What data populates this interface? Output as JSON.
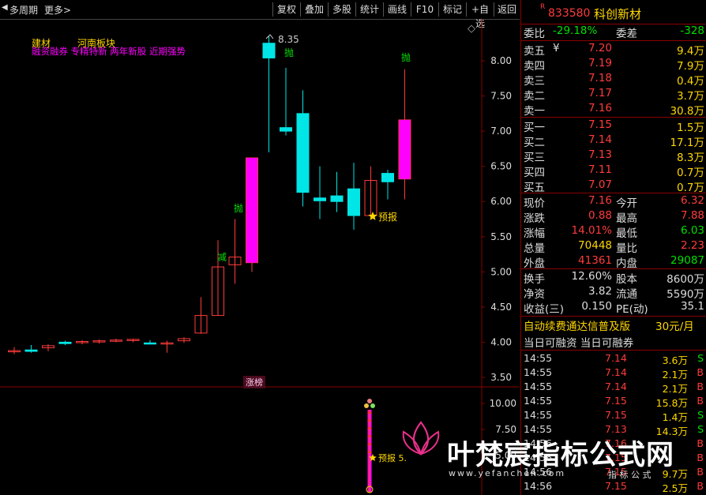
{
  "topbar": {
    "period_label": "多周期",
    "more_label": "更多>",
    "buttons": [
      "复权",
      "叠加",
      "多股",
      "统计",
      "画线",
      "F10",
      "标记",
      "+自选",
      "返回"
    ]
  },
  "chart_data": {
    "type": "candlestick",
    "price_ticks": [
      "8.00",
      "7.50",
      "7.00",
      "6.50",
      "6.00",
      "5.50",
      "5.00",
      "4.50",
      "4.00",
      "3.50"
    ],
    "ylim": [
      3.35,
      8.55
    ],
    "sub_ticks": [
      "10.00",
      "7.50",
      "5.00"
    ],
    "candles": [
      {
        "o": 3.88,
        "h": 3.93,
        "l": 3.83,
        "c": 3.88
      },
      {
        "o": 3.89,
        "h": 3.96,
        "l": 3.85,
        "c": 3.87
      },
      {
        "o": 3.92,
        "h": 3.97,
        "l": 3.87,
        "c": 3.95
      },
      {
        "o": 4.0,
        "h": 4.02,
        "l": 3.96,
        "c": 3.98
      },
      {
        "o": 4.0,
        "h": 4.03,
        "l": 3.97,
        "c": 4.01
      },
      {
        "o": 4.01,
        "h": 4.04,
        "l": 3.98,
        "c": 4.02
      },
      {
        "o": 4.03,
        "h": 4.05,
        "l": 4.0,
        "c": 4.03
      },
      {
        "o": 4.03,
        "h": 4.05,
        "l": 4.0,
        "c": 4.04
      },
      {
        "o": 3.99,
        "h": 4.03,
        "l": 3.97,
        "c": 3.98
      },
      {
        "o": 3.98,
        "h": 4.02,
        "l": 3.85,
        "c": 3.99
      },
      {
        "o": 4.02,
        "h": 4.07,
        "l": 3.99,
        "c": 4.05
      },
      {
        "o": 4.13,
        "h": 4.64,
        "l": 4.12,
        "c": 4.38
      },
      {
        "o": 4.38,
        "h": 5.45,
        "l": 4.38,
        "c": 5.07
      },
      {
        "o": 5.1,
        "h": 5.75,
        "l": 4.83,
        "c": 5.21
      },
      {
        "o": 5.13,
        "h": 6.62,
        "l": 5.0,
        "c": 6.62
      },
      {
        "o": 8.25,
        "h": 8.35,
        "l": 6.7,
        "c": 8.04
      },
      {
        "o": 7.05,
        "h": 7.9,
        "l": 6.94,
        "c": 7.0
      },
      {
        "o": 7.25,
        "h": 7.58,
        "l": 5.93,
        "c": 6.13
      },
      {
        "o": 6.05,
        "h": 6.5,
        "l": 5.75,
        "c": 6.01
      },
      {
        "o": 6.08,
        "h": 6.42,
        "l": 5.85,
        "c": 6.0
      },
      {
        "o": 6.18,
        "h": 6.55,
        "l": 5.6,
        "c": 5.8
      },
      {
        "o": 5.8,
        "h": 6.5,
        "l": 5.77,
        "c": 6.3
      },
      {
        "o": 6.4,
        "h": 6.45,
        "l": 6.03,
        "c": 6.28
      },
      {
        "o": 6.32,
        "h": 7.88,
        "l": 6.03,
        "c": 7.16
      }
    ]
  },
  "chart_labels": {
    "sector1": "建材",
    "sector2": "河南板块",
    "tags": "融资融券 专精特新 两年新股 近期强势",
    "max_price": "8.35",
    "sell_mark": "抛",
    "reduce_mark": "减",
    "forecast_mark": "预报",
    "limit_label": "涨榜",
    "diamond_icon": "◇",
    "sub_forecast": "预报 5.",
    "sub_num": "5"
  },
  "panel": {
    "badge": "R",
    "code": "833580",
    "name": "科创新材",
    "commit_ratio_label": "委比",
    "commit_ratio": "-29.18%",
    "commit_diff_label": "委差",
    "commit_diff": "-328",
    "asks": [
      {
        "label": "卖五",
        "price": "7.20",
        "vol": "9.4万",
        "mark": "¥"
      },
      {
        "label": "卖四",
        "price": "7.19",
        "vol": "7.9万",
        "mark": ""
      },
      {
        "label": "卖三",
        "price": "7.18",
        "vol": "0.4万",
        "mark": ""
      },
      {
        "label": "卖二",
        "price": "7.17",
        "vol": "3.7万",
        "mark": ""
      },
      {
        "label": "卖一",
        "price": "7.16",
        "vol": "30.8万",
        "mark": ""
      }
    ],
    "bids": [
      {
        "label": "买一",
        "price": "7.15",
        "vol": "1.5万"
      },
      {
        "label": "买二",
        "price": "7.14",
        "vol": "17.1万"
      },
      {
        "label": "买三",
        "price": "7.13",
        "vol": "8.3万"
      },
      {
        "label": "买四",
        "price": "7.11",
        "vol": "0.7万"
      },
      {
        "label": "买五",
        "price": "7.07",
        "vol": "0.7万"
      }
    ],
    "stats": [
      {
        "l1": "现价",
        "v1": "7.16",
        "c1": "#ff3b3b",
        "l2": "今开",
        "v2": "6.32",
        "c2": "#ff3b3b"
      },
      {
        "l1": "涨跌",
        "v1": "0.88",
        "c1": "#ff3b3b",
        "l2": "最高",
        "v2": "7.88",
        "c2": "#ff3b3b"
      },
      {
        "l1": "涨幅",
        "v1": "14.01%",
        "c1": "#ff3b3b",
        "l2": "最低",
        "v2": "6.03",
        "c2": "#00e000"
      },
      {
        "l1": "总量",
        "v1": "70448",
        "c1": "#ffd700",
        "l2": "量比",
        "v2": "2.23",
        "c2": "#ff3b3b"
      },
      {
        "l1": "外盘",
        "v1": "41361",
        "c1": "#ff3b3b",
        "l2": "内盘",
        "v2": "29087",
        "c2": "#00e000"
      }
    ],
    "fund": [
      {
        "l1": "换手",
        "v1": "12.60%",
        "l2": "股本",
        "v2": "8600万"
      },
      {
        "l1": "净资",
        "v1": "3.82",
        "l2": "流通",
        "v2": "5590万"
      },
      {
        "l1": "收益(三)",
        "v1": "0.150",
        "l2": "PE(动)",
        "v2": "35.1"
      }
    ],
    "ad_text": "自动续费通达信普及版",
    "ad_price": "30元/月",
    "margin_text": "当日可融资 当日可融券",
    "ticks": [
      {
        "time": "14:55",
        "price": "7.14",
        "vol": "3.6万",
        "side": "S"
      },
      {
        "time": "14:55",
        "price": "7.14",
        "vol": "2.1万",
        "side": "B"
      },
      {
        "time": "14:55",
        "price": "7.14",
        "vol": "2.1万",
        "side": "B"
      },
      {
        "time": "14:55",
        "price": "7.15",
        "vol": "15.8万",
        "side": "B"
      },
      {
        "time": "14:55",
        "price": "7.15",
        "vol": "1.4万",
        "side": "S"
      },
      {
        "time": "14:55",
        "price": "7.13",
        "vol": "14.3万",
        "side": "S"
      },
      {
        "time": "14:56",
        "price": "7.16",
        "vol": "",
        "side": "B"
      },
      {
        "time": "14:56",
        "price": "7.15",
        "vol": "",
        "side": "B"
      },
      {
        "time": "14:56",
        "price": "7.15",
        "vol": "9.7万",
        "side": "B"
      },
      {
        "time": "14:56",
        "price": "7.15",
        "vol": "2.5万",
        "side": "B"
      }
    ]
  },
  "watermark": {
    "title": "叶梵宸指标公式网",
    "url": "www.yefanchen.com",
    "sub": "指 标 公 式"
  },
  "colors": {
    "up": "#ff3b3b",
    "down": "#00e5e5",
    "boardmag": "#ff00ff",
    "bg": "#000000"
  }
}
